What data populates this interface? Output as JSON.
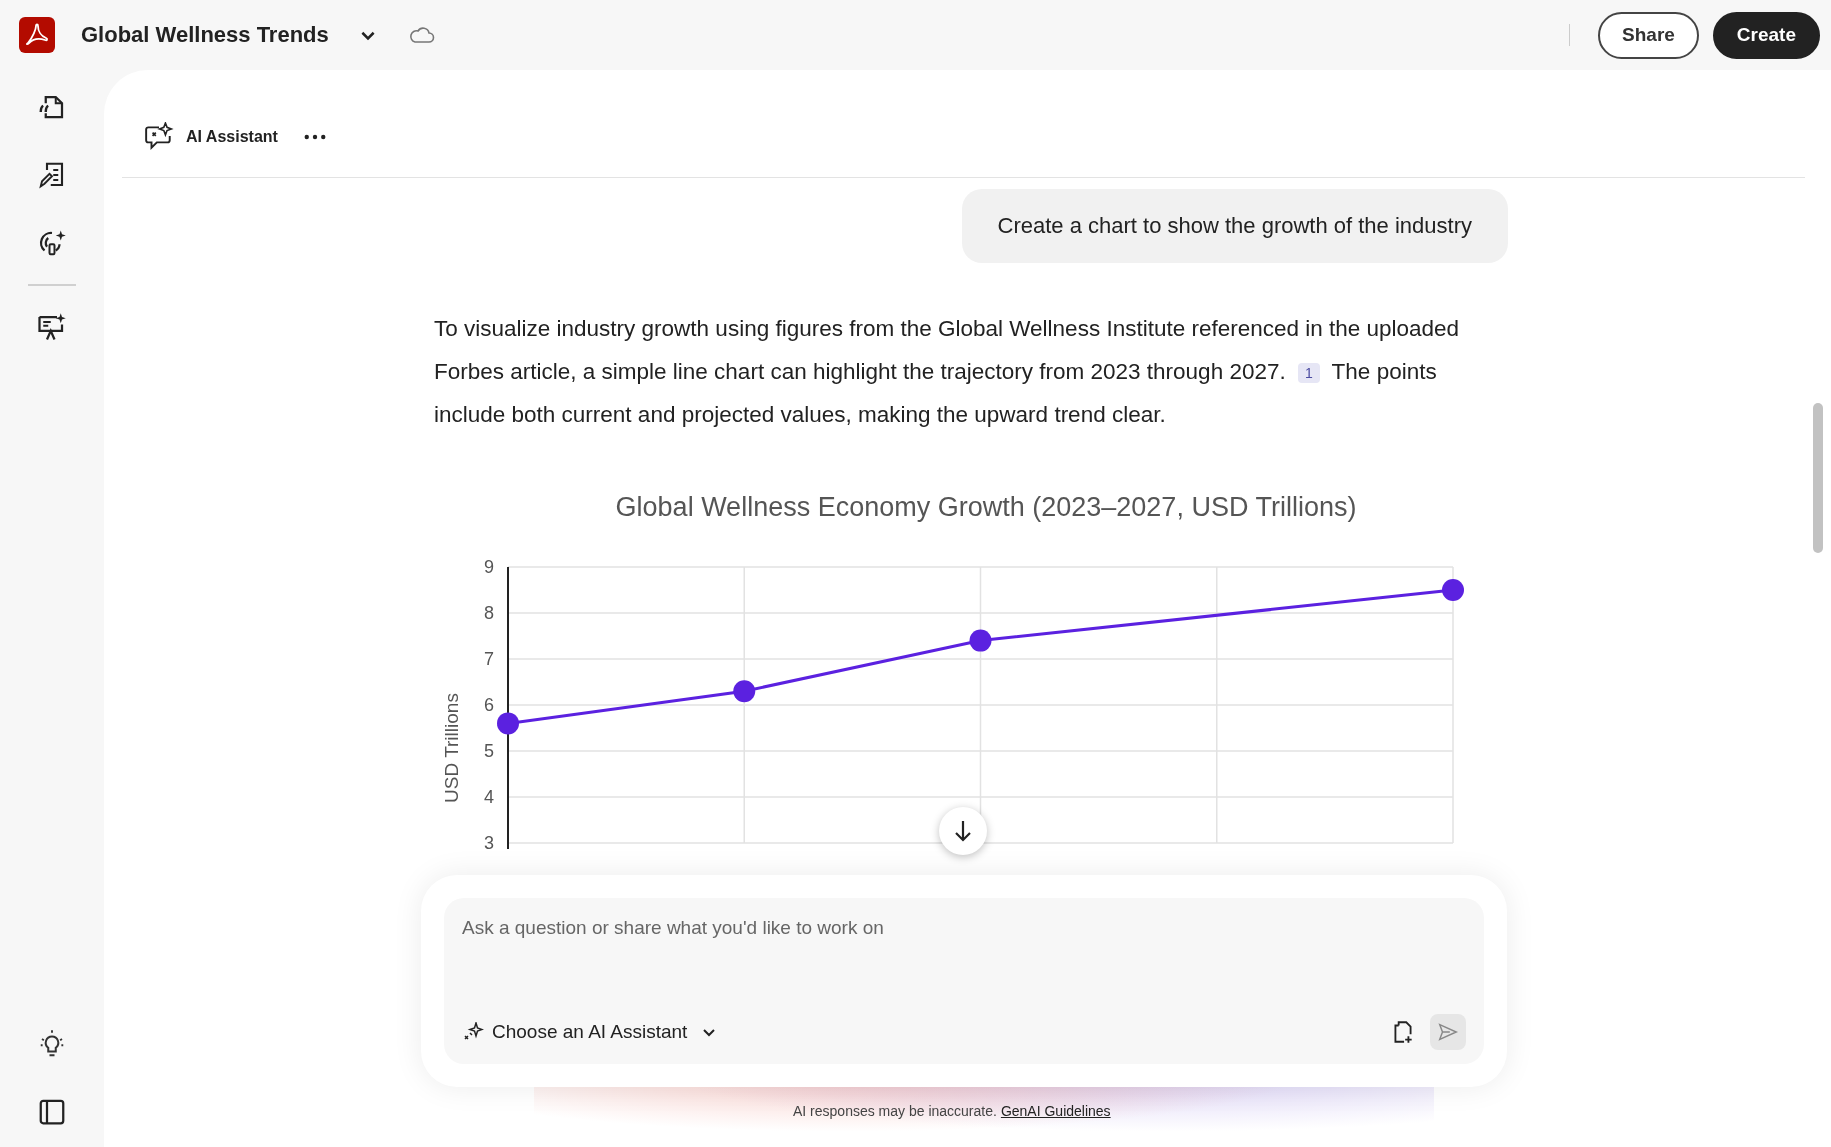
{
  "window": {
    "title": "Global Wellness Trends"
  },
  "top_bar": {
    "buttons": [
      {
        "label": "Share",
        "kind": "outline"
      },
      {
        "label": "Create",
        "kind": "filled"
      }
    ]
  },
  "panel": {
    "title": "AI Assistant"
  },
  "conversation": {
    "user_message": "Create a chart to show the growth of the industry",
    "answer": [
      "To visualize industry growth using figures from the Global Wellness Institute referenced in the uploaded Forbes article, a simple line chart can highlight the trajectory from 2023 through 2027.",
      "1",
      "The points include both current and projected values, making the upward trend clear."
    ],
    "chart_data": {
      "type": "line",
      "grid": true,
      "title": "Global Wellness Economy Growth (2023–2027, USD Trillions)",
      "ylabel": "USD Trillions",
      "ylim": [
        3,
        9
      ],
      "yticks": [
        3,
        4,
        5,
        6,
        7,
        8,
        9
      ],
      "series": [
        {
          "color": "#5b21e0",
          "marker": true,
          "values": [
            5.6,
            6.3,
            7.4,
            null,
            8.5
          ]
        }
      ]
    }
  },
  "composer": {
    "placeholder": "Ask a question or share what you'd like to work on",
    "assistant_picker": "Choose an AI Assistant"
  },
  "footer": {
    "note": "AI responses may be inaccurate.",
    "link": "GenAI Guidelines"
  }
}
